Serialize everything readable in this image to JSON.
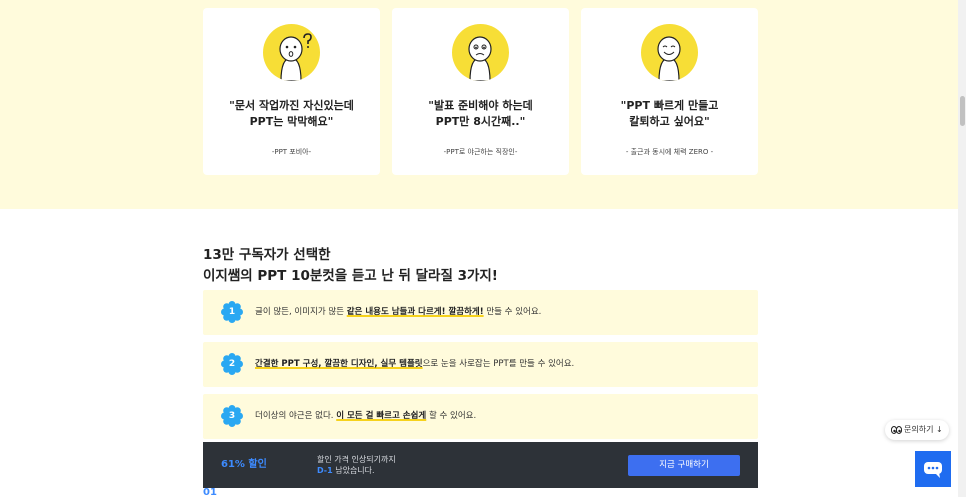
{
  "testimonials": [
    {
      "quote_line1": "\"문서 작업까진 자신있는데",
      "quote_line2": "PPT는 막막해요\"",
      "author": "-PPT 포비아-"
    },
    {
      "quote_line1": "\"발표 준비해야 하는데",
      "quote_line2": "PPT만 8시간째..\"",
      "author": "-PPT로 야근하는 직장인-"
    },
    {
      "quote_line1": "\"PPT 빠르게 만들고",
      "quote_line2": "칼퇴하고 싶어요\"",
      "author": "- 출근과 동시에 체력 ZERO -"
    }
  ],
  "section": {
    "heading_line1": "13만 구독자가 선택한",
    "heading_line2": "이지쌤의 PPT 10분컷을 듣고 난 뒤 달라질 3가지!"
  },
  "benefits": [
    {
      "number": "1",
      "pre": "글이 많든, 이미지가 많든 ",
      "highlight": "같은 내용도 남들과 다르게! 깔끔하게!",
      "post": " 만들 수 있어요."
    },
    {
      "number": "2",
      "pre": "",
      "highlight": "간결한 PPT 구성, 깔끔한 디자인, 실무 템플릿",
      "post": "으로 눈을 사로잡는 PPT를 만들 수 있어요."
    },
    {
      "number": "3",
      "pre": "더이상의 야근은 없다. ",
      "highlight": "이 모든 걸 빠르고 손쉽게",
      "post": " 할 수 있어요."
    }
  ],
  "purchase_bar": {
    "discount": "61% 할인",
    "deadline_line1": "할인 가격 인상되기까지",
    "dday": "D-1",
    "deadline_line2_rest": " 남았습니다.",
    "button_label": "지금 구매하기"
  },
  "next_step_number": "01",
  "floating": {
    "inquiry_label": "문의하기 ↓"
  },
  "colors": {
    "band": "#fffbdc",
    "accent_yellow": "#f7de36",
    "accent_blue": "#3d8bff",
    "badge_blue": "#2aa8f2",
    "bar_dark": "#2d3238"
  }
}
